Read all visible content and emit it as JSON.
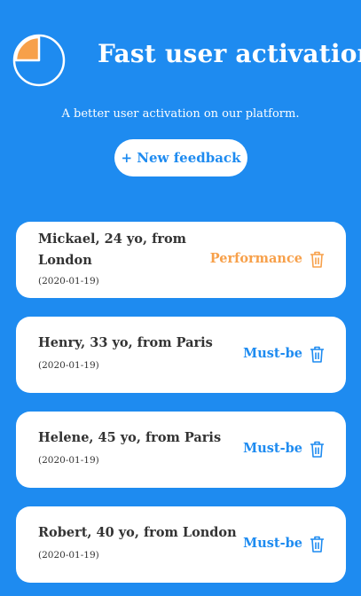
{
  "header": {
    "title": "Fast user activation",
    "subtitle": "A better user activation on our platform.",
    "logo_icon": "pie-chart-icon"
  },
  "new_feedback_label": "+ New feedback",
  "colors": {
    "background": "#1e8bf0",
    "performance": "#f7a04a",
    "must_be": "#1e8bf0",
    "card": "#ffffff",
    "text": "#333333"
  },
  "feedbacks": [
    {
      "who": "Mickael, 24 yo, from London",
      "date": "(2020-01-19)",
      "category": "Performance"
    },
    {
      "who": "Henry, 33 yo, from Paris",
      "date": "(2020-01-19)",
      "category": "Must-be"
    },
    {
      "who": "Helene, 45 yo, from Paris",
      "date": "(2020-01-19)",
      "category": "Must-be"
    },
    {
      "who": "Robert, 40 yo, from London",
      "date": "(2020-01-19)",
      "category": "Must-be"
    }
  ]
}
